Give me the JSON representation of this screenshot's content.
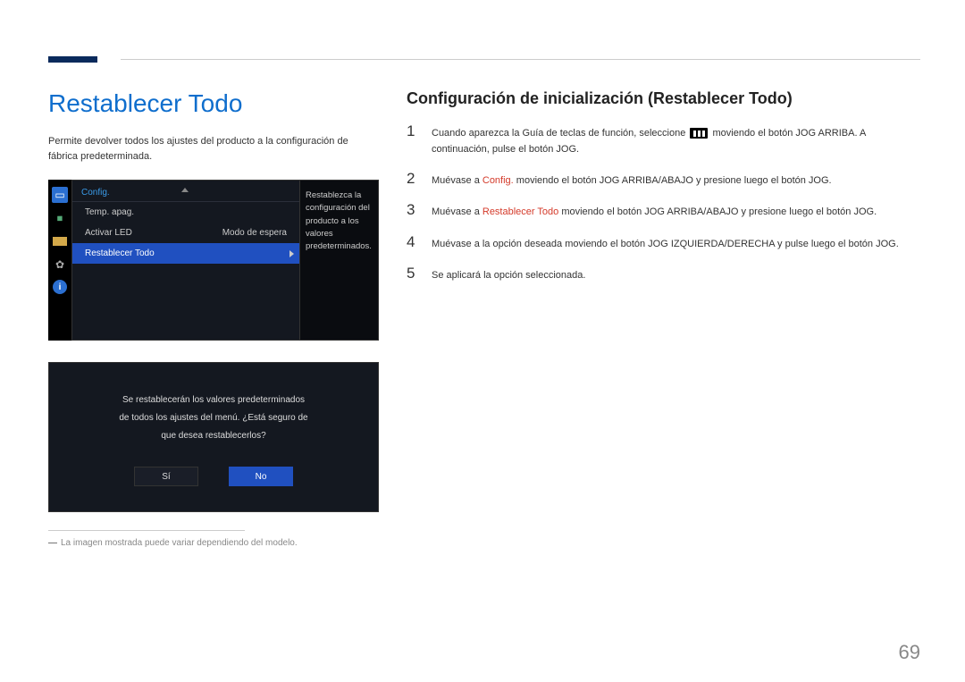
{
  "page_number": "69",
  "left": {
    "title": "Restablecer Todo",
    "intro": "Permite devolver todos los ajustes del producto a la configuración de fábrica predeterminada.",
    "osd": {
      "header": "Config.",
      "rows": [
        {
          "label": "Temp. apag.",
          "value": ""
        },
        {
          "label": "Activar LED",
          "value": "Modo de espera"
        },
        {
          "label": "Restablecer Todo",
          "value": ""
        }
      ],
      "help": "Restablezca la configuración del producto a los valores predeterminados."
    },
    "dialog": {
      "line1": "Se restablecerán los valores predeterminados",
      "line2": "de todos los ajustes del menú. ¿Está seguro de",
      "line3": "que desea restablecerlos?",
      "yes": "Sí",
      "no": "No"
    },
    "footnote_dash": "―",
    "footnote": "La imagen mostrada puede variar dependiendo del modelo."
  },
  "right": {
    "subtitle": "Configuración de inicialización (Restablecer Todo)",
    "steps": [
      {
        "num": "1",
        "pre": "Cuando aparezca la Guía de teclas de función, seleccione ",
        "post": " moviendo el botón JOG ARRIBA. A continuación, pulse el botón JOG."
      },
      {
        "num": "2",
        "pre": "Muévase a ",
        "red": "Config.",
        "post": " moviendo el botón JOG ARRIBA/ABAJO y presione luego el botón JOG."
      },
      {
        "num": "3",
        "pre": "Muévase a ",
        "red": "Restablecer Todo",
        "post": " moviendo el botón JOG ARRIBA/ABAJO y presione luego el botón JOG."
      },
      {
        "num": "4",
        "text": "Muévase a la opción deseada moviendo el botón JOG IZQUIERDA/DERECHA y pulse luego el botón JOG."
      },
      {
        "num": "5",
        "text": "Se aplicará la opción seleccionada."
      }
    ]
  }
}
